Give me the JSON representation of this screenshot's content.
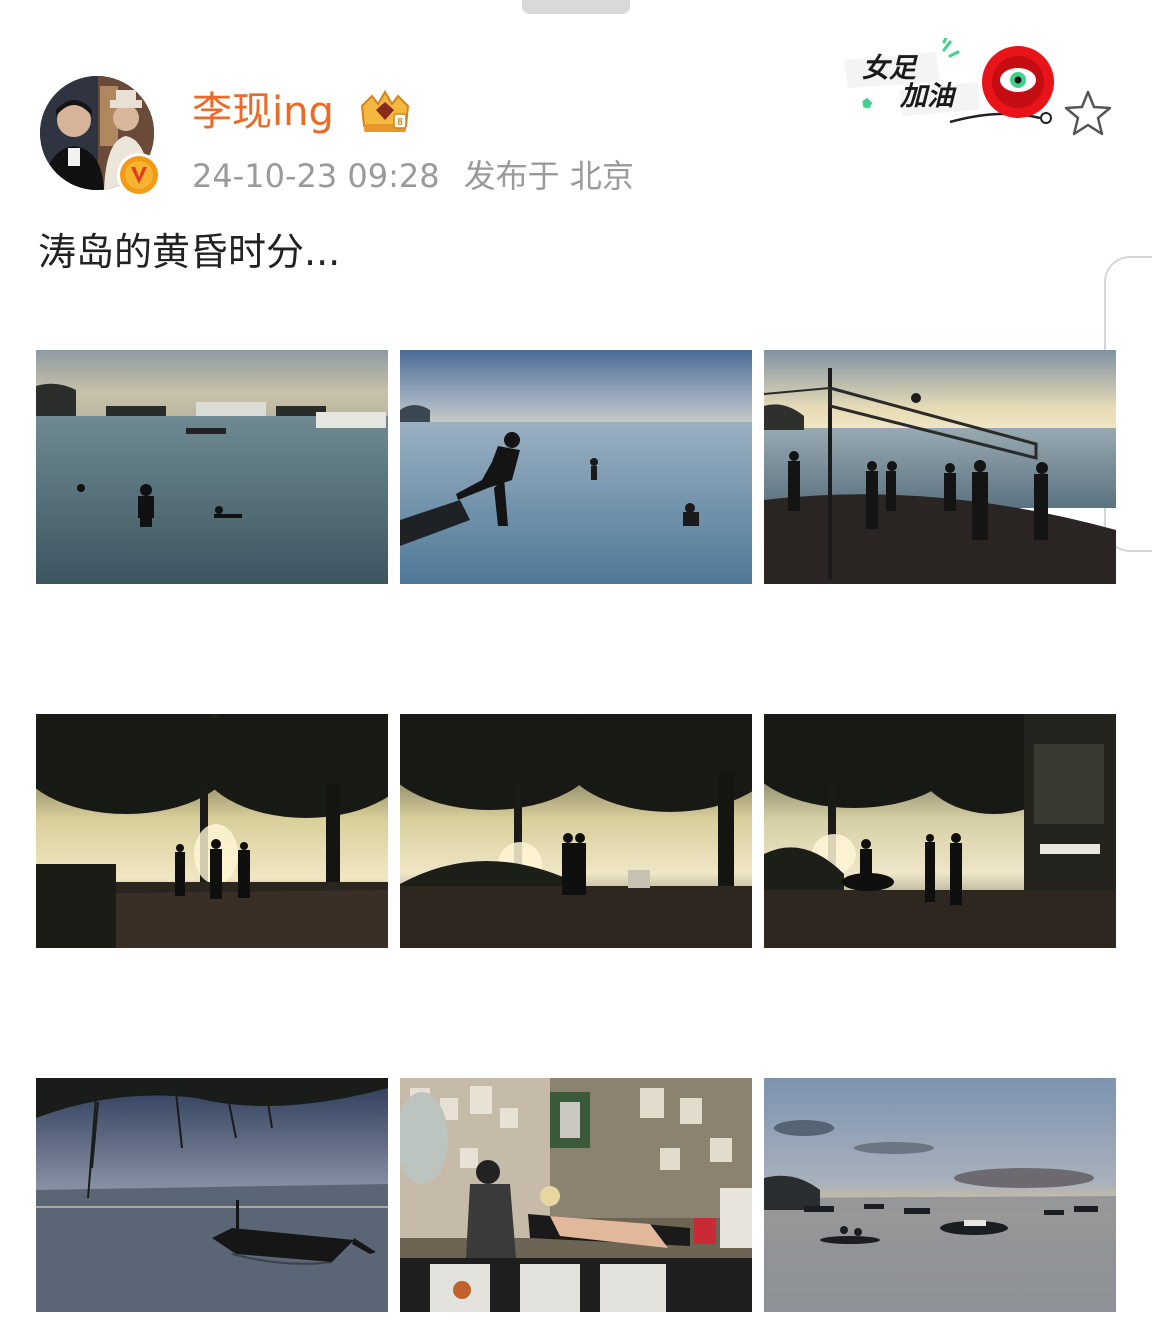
{
  "post": {
    "username": "李现ing",
    "timestamp": "24-10-23 09:28",
    "location": "发布于 北京",
    "text": "涛岛的黄昏时分..."
  },
  "badges": {
    "verified_icon": "verified-v-icon",
    "membership_icon": "crown-badge-icon"
  },
  "sticker": {
    "line1": "女足",
    "line2": "加油"
  },
  "photos": [
    {
      "name": "photo-swimmers-harbor",
      "scene": "swimmers in calm sea with moored boats at dusk"
    },
    {
      "name": "photo-boy-jumping",
      "scene": "silhouette of a boy jumping into the sea"
    },
    {
      "name": "photo-beach-volleyball",
      "scene": "silhouettes playing beach volleyball at sunset"
    },
    {
      "name": "photo-walkers-palms-1",
      "scene": "people walking under palm trees at sunset"
    },
    {
      "name": "photo-walkers-palms-2",
      "scene": "runners under palm trees at sunset"
    },
    {
      "name": "photo-scooter-palms",
      "scene": "scooter rider under palm trees at sunset"
    },
    {
      "name": "photo-longtail-boat",
      "scene": "long-tail boat under hanging branches at sunset"
    },
    {
      "name": "photo-tattoo-shop",
      "scene": "tattoo artist working in a decorated shop"
    },
    {
      "name": "photo-kayak-bay",
      "scene": "kayakers in a bay with boats at dusk"
    }
  ],
  "colors": {
    "username": "#ec6a26",
    "meta": "#9a9a9a",
    "text": "#222222",
    "accent_green": "#3fd28a",
    "sticker_red": "#e8141a"
  }
}
